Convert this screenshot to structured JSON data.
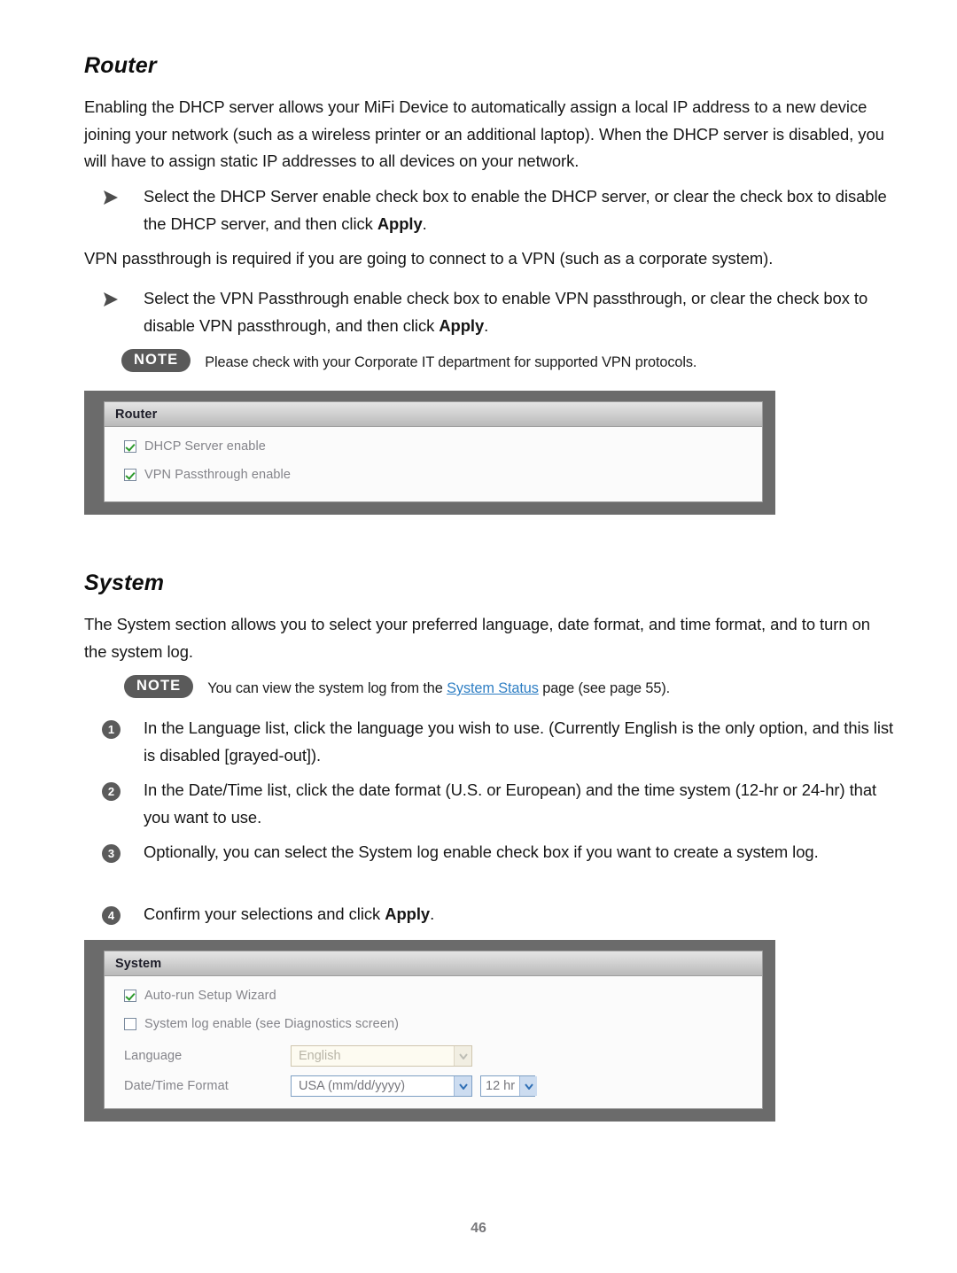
{
  "page": {
    "number": "46"
  },
  "sections": {
    "router": {
      "heading": "Router",
      "intro": "Enabling the DHCP server allows your MiFi Device to automatically assign a local IP address to a new device joining your network (such as a wireless printer or an additional laptop). When the DHCP server is disabled, you will have to assign static IP addresses to all devices on your network.",
      "bullet_dhcp_before": "Select the DHCP Server enable check box to enable the DHCP server, or clear the check box to disable the DHCP server, and then click ",
      "bullet_dhcp_bold": "Apply",
      "bullet_dhcp_after": ".",
      "vpn_intro": "VPN passthrough is required if you are going to connect to a VPN (such as a corporate system).",
      "bullet_vpn_before": "Select the VPN Passthrough enable check box to enable VPN passthrough, or clear the check box to disable VPN passthrough, and then click ",
      "bullet_vpn_bold": "Apply",
      "bullet_vpn_after": ".",
      "note": {
        "badge": "NOTE",
        "text": "Please check with your Corporate IT department for supported VPN protocols."
      },
      "screenshot": {
        "title": "Router",
        "checkboxes": [
          {
            "label": "DHCP Server enable",
            "checked": true
          },
          {
            "label": "VPN Passthrough enable",
            "checked": true
          }
        ]
      }
    },
    "system": {
      "heading": "System",
      "intro": "The System section allows you to select your preferred language, date format, and time format, and to turn on the system log.",
      "note": {
        "badge": "NOTE",
        "text_before": "You can view the system log from the ",
        "link": "System Status",
        "text_after": " page (see page 55)."
      },
      "steps": [
        {
          "number": "1",
          "text": "In the Language list, click the language you wish to use. (Currently English is the only option, and this list is disabled [grayed-out])."
        },
        {
          "number": "2",
          "text": "In the Date/Time list, click the date format (U.S. or European) and the time system (12-hr or 24-hr) that you want to use."
        },
        {
          "number": "3",
          "text": "Optionally, you can select the System log enable check box if you want to create a system log."
        },
        {
          "number": "4",
          "text_before": "Confirm your selections and click ",
          "text_bold": "Apply",
          "text_after": "."
        }
      ],
      "screenshot": {
        "title": "System",
        "checkboxes": [
          {
            "label": "Auto-run Setup Wizard",
            "checked": true
          },
          {
            "label": "System log enable (see Diagnostics screen)",
            "checked": false
          }
        ],
        "fields": [
          {
            "label": "Language",
            "value": "English",
            "disabled": true
          },
          {
            "label": "Date/Time Format",
            "value": "USA (mm/dd/yyyy)",
            "value2": "12 hr",
            "disabled": false
          }
        ]
      }
    }
  },
  "colors": {
    "frame_gray": "#6b6b6b",
    "link_blue": "#2f7fc4",
    "check_green": "#2c9a2c",
    "note_badge": "#5a5a5a"
  }
}
